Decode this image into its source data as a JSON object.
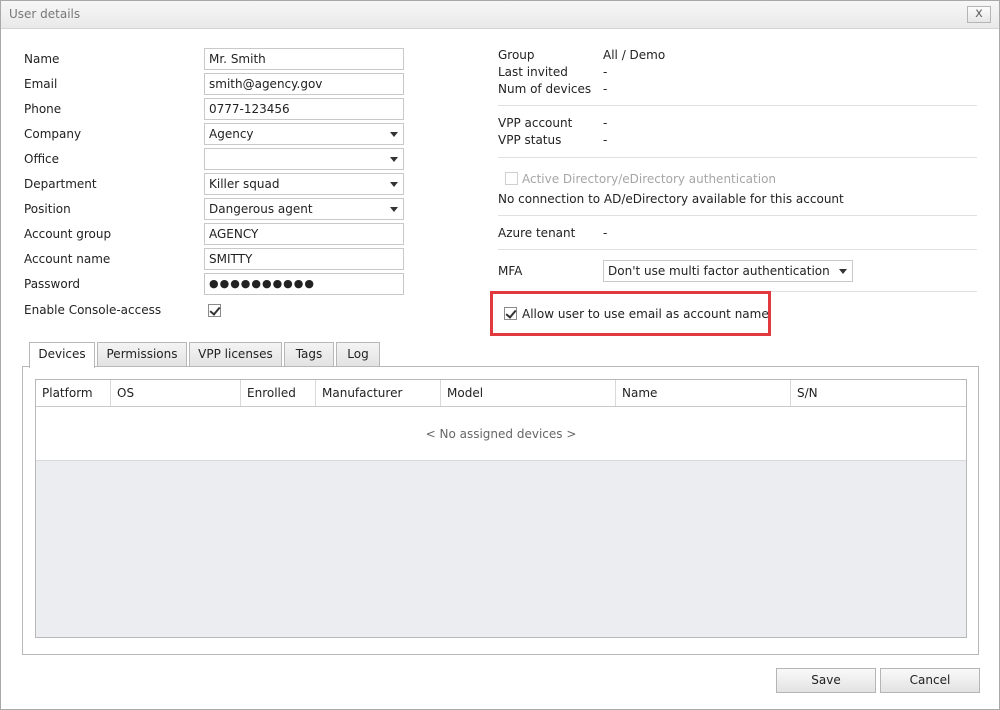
{
  "window": {
    "title": "User details",
    "close_label": "x"
  },
  "form": {
    "name_label": "Name",
    "name_value": "Mr. Smith",
    "email_label": "Email",
    "email_value": "smith@agency.gov",
    "phone_label": "Phone",
    "phone_value": "0777-123456",
    "company_label": "Company",
    "company_value": "Agency",
    "office_label": "Office",
    "office_value": "",
    "department_label": "Department",
    "department_value": "Killer squad",
    "position_label": "Position",
    "position_value": "Dangerous agent",
    "account_group_label": "Account group",
    "account_group_value": "AGENCY",
    "account_name_label": "Account name",
    "account_name_value": "SMITTY",
    "password_label": "Password",
    "password_value": "●●●●●●●●●●",
    "console_access_label": "Enable Console-access",
    "console_access_checked": true
  },
  "info": {
    "group_label": "Group",
    "group_value": "All / Demo",
    "last_invited_label": "Last invited",
    "last_invited_value": "-",
    "num_devices_label": "Num of devices",
    "num_devices_value": "-",
    "vpp_account_label": "VPP account",
    "vpp_account_value": "-",
    "vpp_status_label": "VPP status",
    "vpp_status_value": "-",
    "ad_auth_label": "Active Directory/eDirectory authentication",
    "ad_note": "No connection to AD/eDirectory available for this account",
    "azure_label": "Azure tenant",
    "azure_value": "-",
    "mfa_label": "MFA",
    "mfa_value": "Don't use multi factor authentication",
    "email_as_account_label": "Allow user to use email as account name",
    "email_as_account_checked": true
  },
  "tabs": [
    {
      "label": "Devices",
      "active": true
    },
    {
      "label": "Permissions"
    },
    {
      "label": "VPP licenses"
    },
    {
      "label": "Tags"
    },
    {
      "label": "Log"
    }
  ],
  "devices_table": {
    "columns": [
      "Platform",
      "OS",
      "Enrolled",
      "Manufacturer",
      "Model",
      "Name",
      "S/N"
    ],
    "empty_message": "< No assigned devices >"
  },
  "buttons": {
    "save": "Save",
    "cancel": "Cancel"
  },
  "colors": {
    "highlight_border": "#e0393e"
  }
}
